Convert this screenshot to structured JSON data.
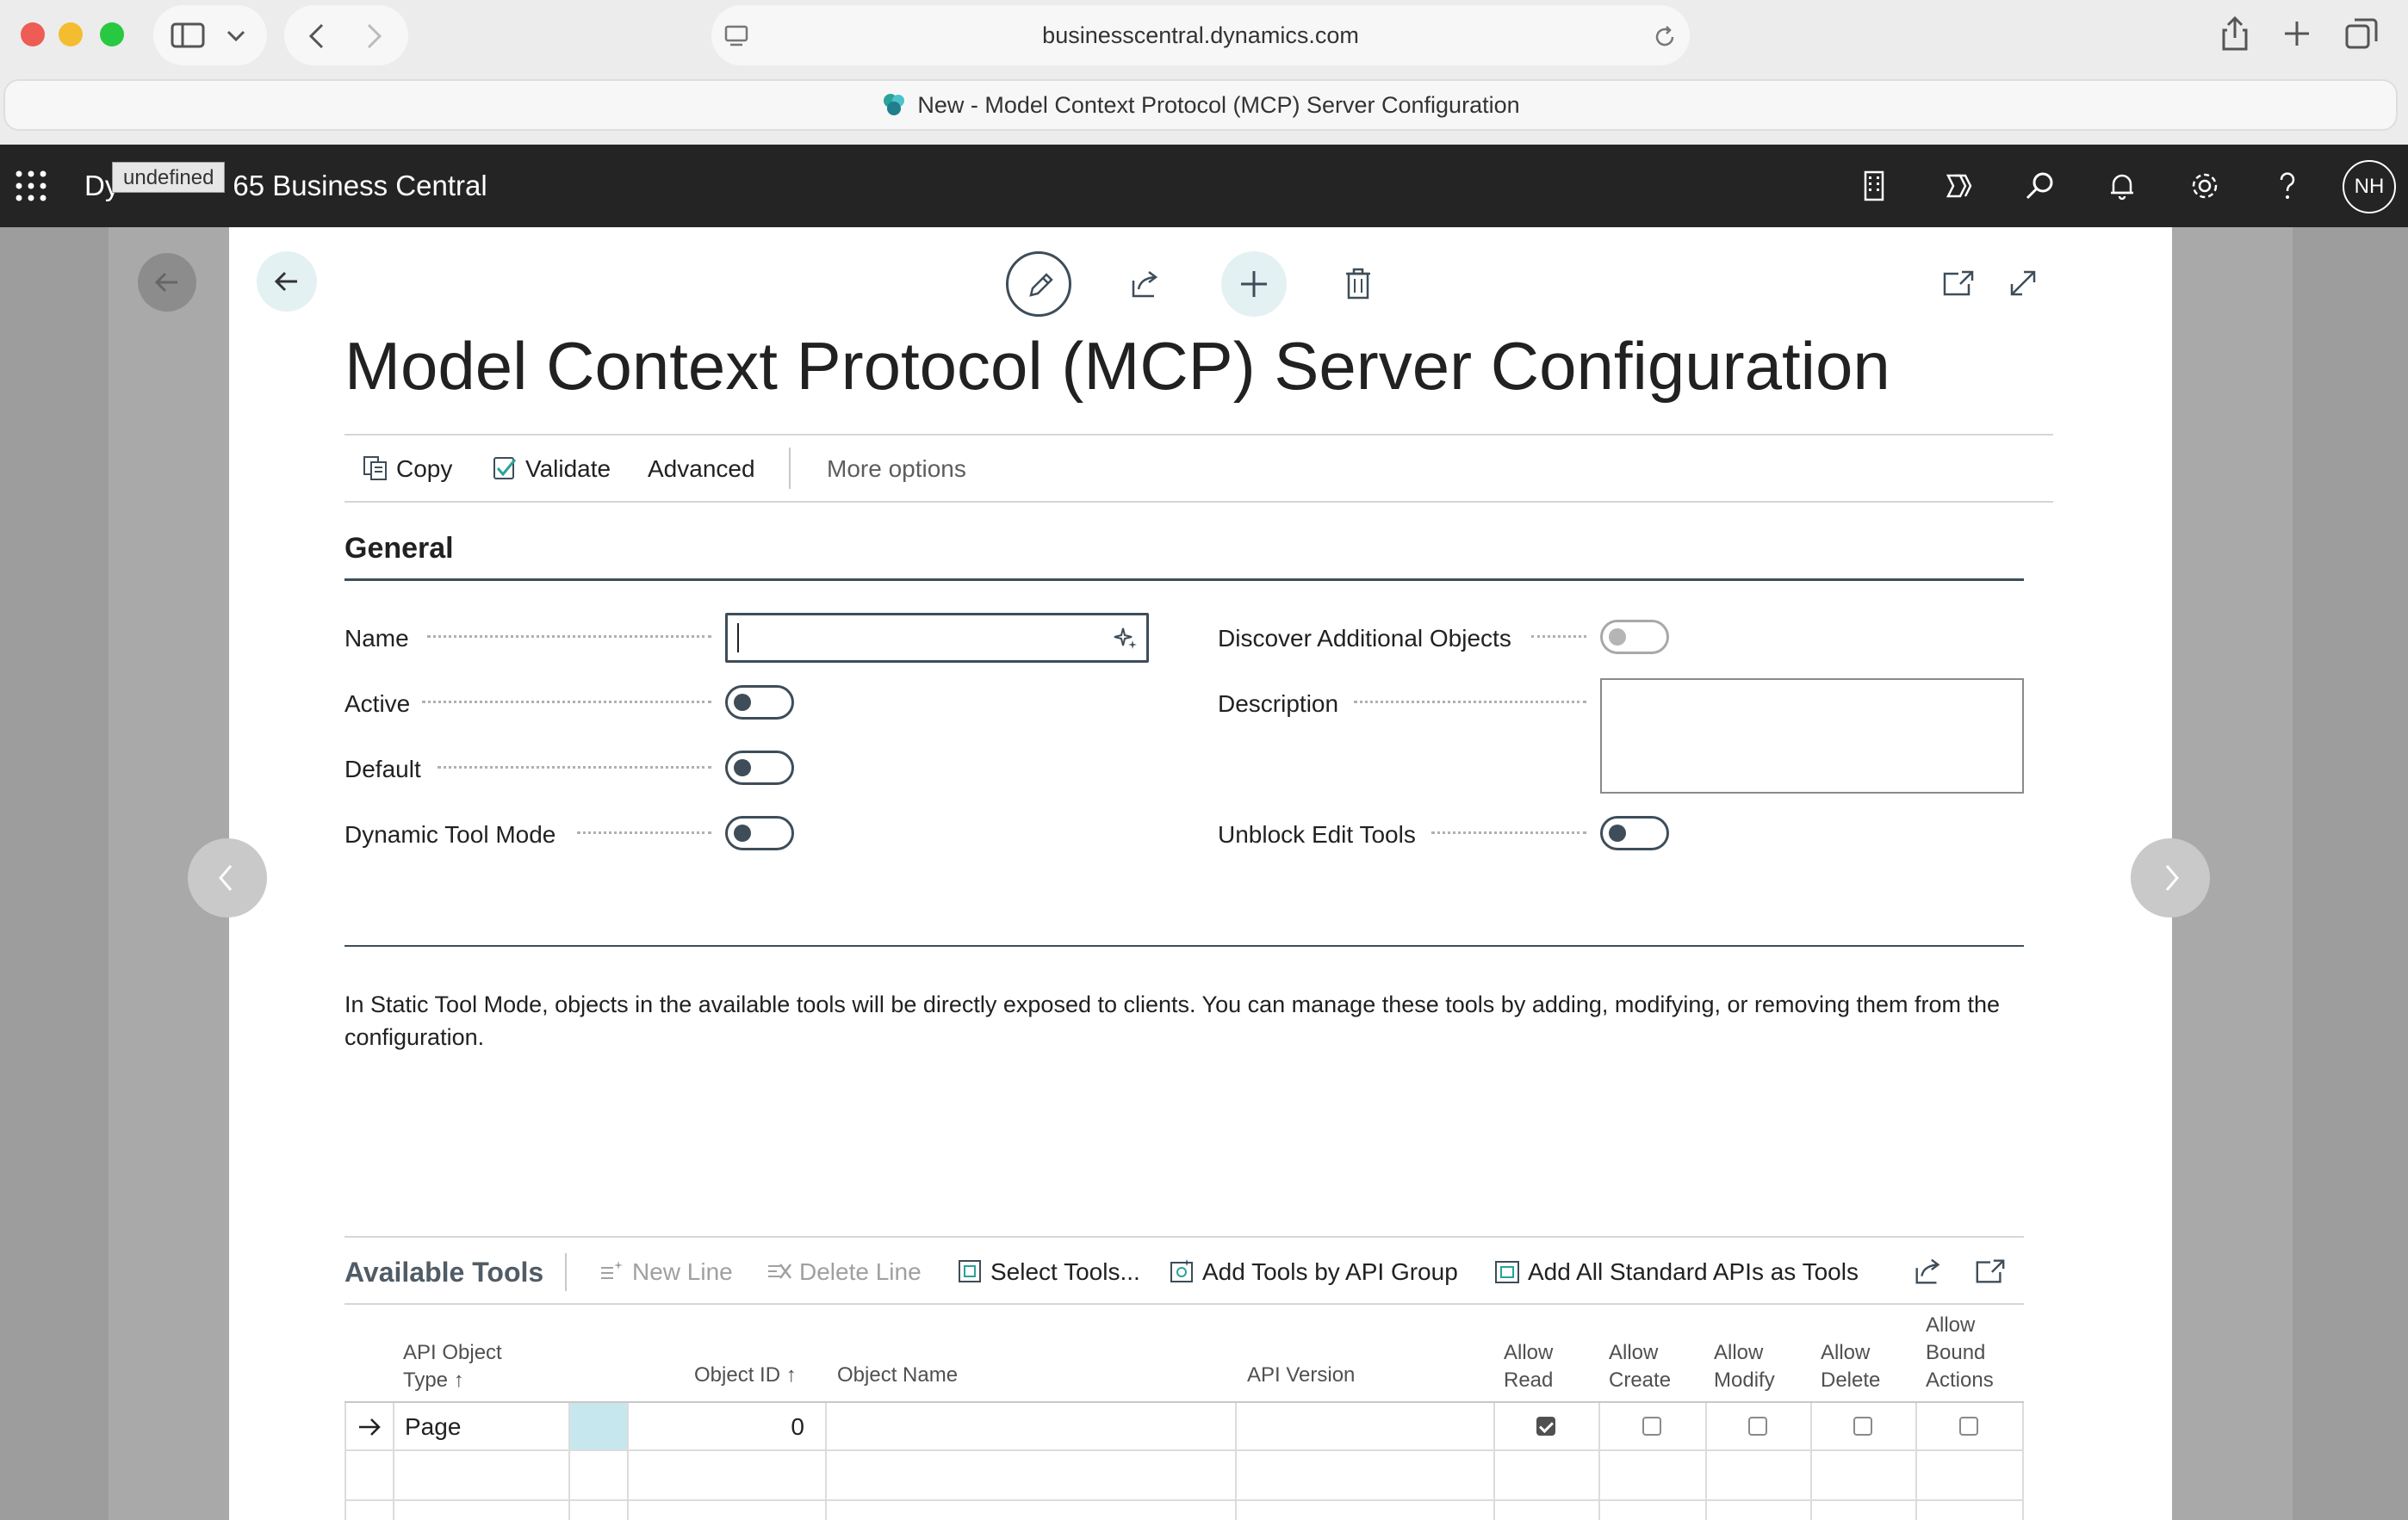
{
  "browser": {
    "url": "businesscentral.dynamics.com",
    "tab_title": "New - Model Context Protocol (MCP) Server Configuration"
  },
  "app": {
    "name_prefix": "Dy",
    "name_suffix": "65 Business Central",
    "tooltip": "undefined",
    "user_initials": "NH"
  },
  "page": {
    "title": "Model Context Protocol (MCP) Server Configuration",
    "actions": {
      "copy": "Copy",
      "validate": "Validate",
      "advanced": "Advanced",
      "more_options": "More options"
    }
  },
  "general": {
    "title": "General",
    "fields": {
      "name": {
        "label": "Name",
        "value": ""
      },
      "active": {
        "label": "Active",
        "value": false
      },
      "default": {
        "label": "Default",
        "value": false
      },
      "dynamic_tool_mode": {
        "label": "Dynamic Tool Mode",
        "value": false
      },
      "discover_additional_objects": {
        "label": "Discover Additional Objects",
        "value": false,
        "disabled": true
      },
      "description": {
        "label": "Description",
        "value": ""
      },
      "unblock_edit_tools": {
        "label": "Unblock Edit Tools",
        "value": false
      }
    },
    "info": "In Static Tool Mode, objects in the available tools will be directly exposed to clients. You can manage these tools by adding, modifying, or removing them from the configuration."
  },
  "tools": {
    "title": "Available Tools",
    "actions": {
      "new_line": "New Line",
      "delete_line": "Delete Line",
      "select_tools": "Select Tools...",
      "add_by_api_group": "Add Tools by API Group",
      "add_all_standard": "Add All Standard APIs as Tools"
    },
    "columns": {
      "api_object_type_1": "API Object",
      "api_object_type_2": "Type ↑",
      "object_id": "Object ID ↑",
      "object_name": "Object Name",
      "api_version": "API Version",
      "allow_read_1": "Allow",
      "allow_read_2": "Read",
      "allow_create_1": "Allow",
      "allow_create_2": "Create",
      "allow_modify_1": "Allow",
      "allow_modify_2": "Modify",
      "allow_delete_1": "Allow",
      "allow_delete_2": "Delete",
      "allow_bound_1": "Allow",
      "allow_bound_2": "Bound",
      "allow_bound_3": "Actions"
    },
    "rows": [
      {
        "api_object_type": "Page",
        "object_id": "0",
        "object_name": "",
        "api_version": "",
        "allow_read": true,
        "allow_create": false,
        "allow_modify": false,
        "allow_delete": false,
        "allow_bound_actions": false
      }
    ]
  },
  "colors": {
    "accent": "#3e4d59",
    "bc_bar": "#242424",
    "teal_circle": "#e3f1f3"
  }
}
